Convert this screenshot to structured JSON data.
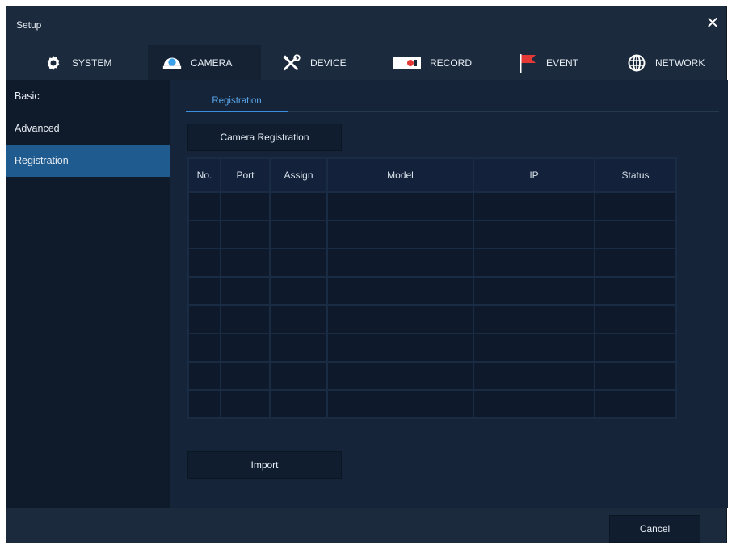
{
  "window": {
    "title": "Setup",
    "close_symbol": "✕"
  },
  "tabs": [
    {
      "label": "SYSTEM",
      "icon": "gear-icon"
    },
    {
      "label": "CAMERA",
      "icon": "camera-icon",
      "active": true
    },
    {
      "label": "DEVICE",
      "icon": "tools-icon"
    },
    {
      "label": "RECORD",
      "icon": "record-icon"
    },
    {
      "label": "EVENT",
      "icon": "flag-icon"
    },
    {
      "label": "NETWORK",
      "icon": "globe-icon"
    }
  ],
  "sidebar": {
    "items": [
      {
        "label": "Basic"
      },
      {
        "label": "Advanced"
      },
      {
        "label": "Registration",
        "active": true
      }
    ]
  },
  "content": {
    "subtab": "Registration",
    "register_button": "Camera Registration",
    "import_button": "Import",
    "table": {
      "columns": [
        "No.",
        "Port",
        "Assign",
        "Model",
        "IP",
        "Status"
      ],
      "rows": 8
    }
  },
  "footer": {
    "cancel_button": "Cancel"
  },
  "colors": {
    "accent": "#3b8fe0",
    "selected_side": "#1f5b8e",
    "event_flag": "#e53935"
  }
}
